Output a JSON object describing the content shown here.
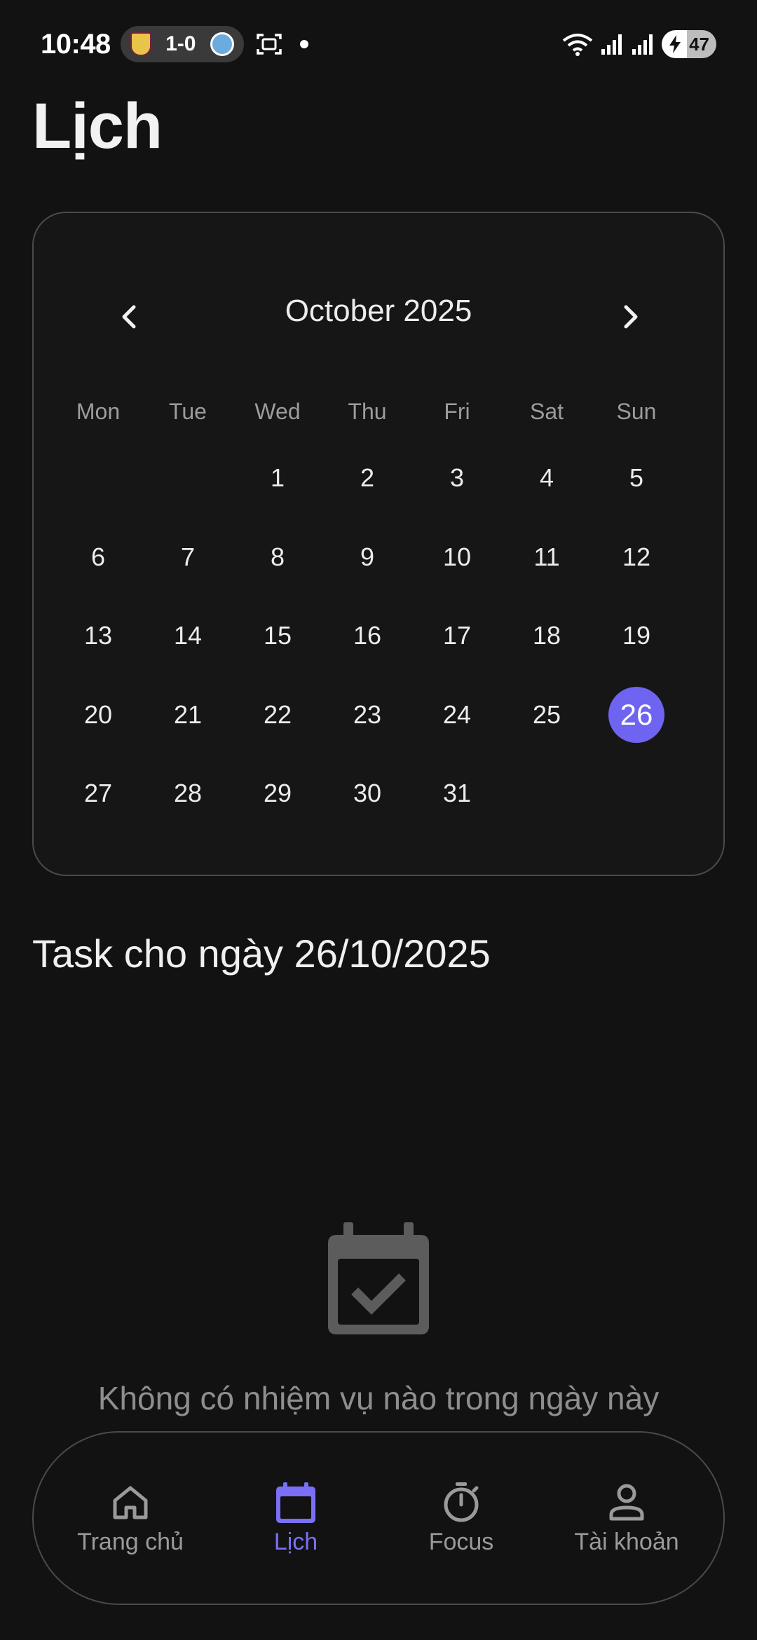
{
  "status_bar": {
    "time": "10:48",
    "score": "1-0",
    "battery": "47"
  },
  "page": {
    "title": "Lịch"
  },
  "calendar": {
    "month_label": "October 2025",
    "weekdays": [
      "Mon",
      "Tue",
      "Wed",
      "Thu",
      "Fri",
      "Sat",
      "Sun"
    ],
    "days": [
      "",
      "",
      "1",
      "2",
      "3",
      "4",
      "5",
      "6",
      "7",
      "8",
      "9",
      "10",
      "11",
      "12",
      "13",
      "14",
      "15",
      "16",
      "17",
      "18",
      "19",
      "20",
      "21",
      "22",
      "23",
      "24",
      "25",
      "26",
      "27",
      "28",
      "29",
      "30",
      "31",
      "",
      ""
    ],
    "selected_day": "26",
    "accent": "#6f63f2"
  },
  "tasks": {
    "heading": "Task cho ngày 26/10/2025",
    "empty_message": "Không có nhiệm vụ nào trong ngày này",
    "empty_icon": "calendar-check-icon"
  },
  "bottom_nav": {
    "items": [
      {
        "label": "Trang chủ",
        "icon": "home-icon",
        "active": false
      },
      {
        "label": "Lịch",
        "icon": "calendar-icon",
        "active": true
      },
      {
        "label": "Focus",
        "icon": "timer-icon",
        "active": false
      },
      {
        "label": "Tài khoản",
        "icon": "account-icon",
        "active": false
      }
    ],
    "active_color": "#7a6ff5"
  }
}
